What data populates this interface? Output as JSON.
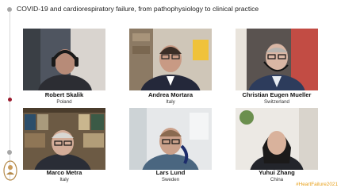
{
  "header": {
    "title": "COVID-19 and cardiorespiratory failure, from pathophysiology to clinical practice"
  },
  "participants": [
    {
      "name": "Robert Skalik",
      "country": "Poland"
    },
    {
      "name": "Andrea Mortara",
      "country": "Italy"
    },
    {
      "name": "Christian Eugen Mueller",
      "country": "Switzerland"
    },
    {
      "name": "Marco Metra",
      "country": "Italy"
    },
    {
      "name": "Lars Lund",
      "country": "Sweden"
    },
    {
      "name": "Yuhui Zhang",
      "country": "China"
    }
  ],
  "footer": {
    "hashtag": "#HeartFailure2021"
  },
  "colors": {
    "accent": "#9b1b2e",
    "hashtag": "#e8a11b"
  },
  "icons": {
    "timeline": "timeline-dot",
    "seal": "heraldic-seal-icon"
  }
}
